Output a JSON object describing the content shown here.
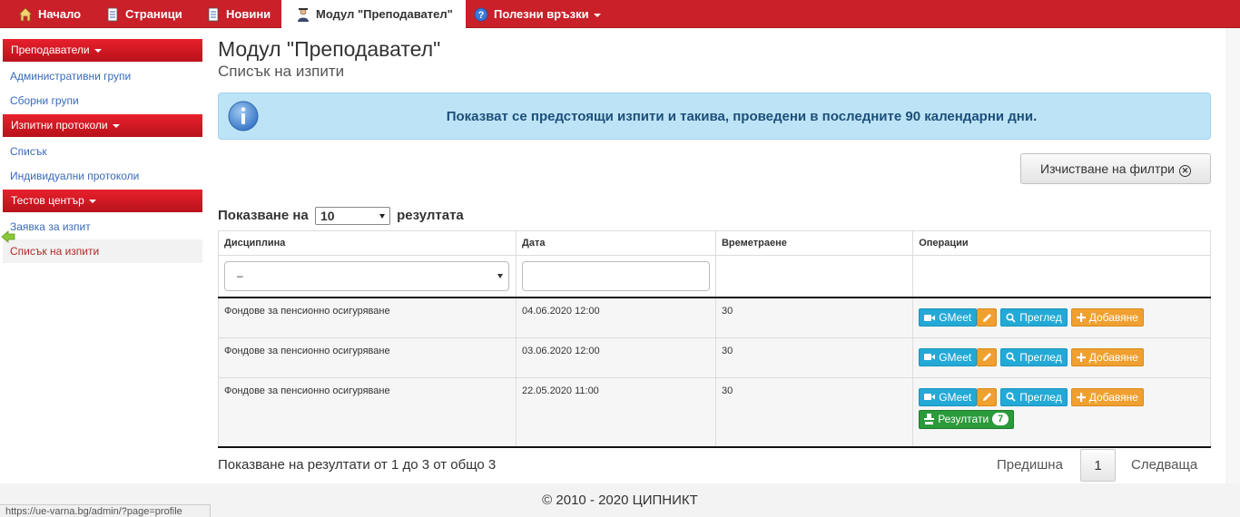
{
  "nav": {
    "items": [
      {
        "label": "Начало",
        "icon": "home-icon"
      },
      {
        "label": "Страници",
        "icon": "page-icon"
      },
      {
        "label": "Новини",
        "icon": "news-icon"
      },
      {
        "label": "Модул \"Преподавател\"",
        "icon": "teacher-icon"
      },
      {
        "label": "Полезни връзки",
        "icon": "help-icon"
      }
    ],
    "active_index": 3,
    "bar_color": "#c9202a"
  },
  "sidebar": {
    "sections": [
      {
        "title": "Преподаватели",
        "links": [
          "Административни групи",
          "Сборни групи"
        ]
      },
      {
        "title": "Изпитни протоколи",
        "links": [
          "Списък",
          "Индивидуални протоколи"
        ]
      },
      {
        "title": "Тестов център",
        "links": [
          "Заявка за изпит",
          "Списък на изпити"
        ]
      }
    ],
    "current_link": "Списък на изпити"
  },
  "page": {
    "title": "Модул \"Преподавател\"",
    "subtitle": "Списък на изпити"
  },
  "info": {
    "text": "Показват се предстоящи изпити и такива, проведени в последните 90 календарни дни."
  },
  "clear_filters": {
    "label": "Изчистване на филтри"
  },
  "length": {
    "prefix": "Показване на",
    "value": "10",
    "suffix": "резултата"
  },
  "table": {
    "headers": [
      "Дисциплина",
      "Дата",
      "Времетраене",
      "Операции"
    ],
    "filter": {
      "discipline": "–",
      "date": ""
    },
    "rows": [
      {
        "discipline": "Фондове за пенсионно осигуряване",
        "date": "04.06.2020 12:00",
        "duration": "30",
        "results": false
      },
      {
        "discipline": "Фондове за пенсионно осигуряване",
        "date": "03.06.2020 12:00",
        "duration": "30",
        "results": false
      },
      {
        "discipline": "Фондове за пенсионно осигуряване",
        "date": "22.05.2020 11:00",
        "duration": "30",
        "results": true
      }
    ],
    "buttons": {
      "gmeet": "GMeet",
      "view": "Преглед",
      "add": "Добавяне",
      "results": "Резултати",
      "results_count": "7"
    }
  },
  "pagination": {
    "info": "Показване на резултати от 1 до 3 от общо 3",
    "prev": "Предишна",
    "page": "1",
    "next": "Следваща"
  },
  "footer": {
    "text": "© 2010 - 2020 ЦИПНИКТ"
  },
  "status_bar": {
    "url": "https://ue-varna.bg/admin/?page=profile"
  }
}
